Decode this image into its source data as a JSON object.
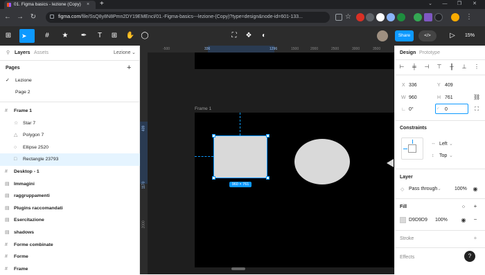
{
  "browser": {
    "tab_title": "01. Figma basics - lezione (Copy)",
    "tab_close": "×",
    "new_tab": "+",
    "url_host": "figma.com",
    "url_path": "/file/SsQ8y8N8Pmn2DY19EMEncI/01.-Figma-basics---lezione-(Copy)?type=design&node-id=601-133...",
    "window_controls": [
      "⌄",
      "—",
      "❐",
      "✕"
    ],
    "nav": {
      "back": "←",
      "forward": "→",
      "reload": "↻"
    },
    "icons": [
      "share-icon",
      "star-icon",
      "extension-icon",
      "profile-icon",
      "menu-icon"
    ]
  },
  "toolbar": {
    "main_menu": "⊞",
    "move": "➤",
    "frame": "#",
    "shape": "★",
    "pen": "✒",
    "text": "T",
    "hand": "✋",
    "comment": "◯",
    "share_label": "Share",
    "devmode_label": "</>",
    "present": "▷",
    "zoom_label": "15%"
  },
  "left_panel": {
    "tabs": [
      "Layers",
      "Assets"
    ],
    "page_select": "Lezione",
    "pages_title": "Pages",
    "add_page": "+",
    "pages": [
      {
        "name": "Lezione",
        "current": true
      },
      {
        "name": "Page 2",
        "current": false
      }
    ],
    "layers": [
      {
        "name": "Frame 1",
        "icon": "#",
        "depth": 0,
        "selected": false
      },
      {
        "name": "Star 7",
        "icon": "☆",
        "depth": 1,
        "selected": false
      },
      {
        "name": "Polygon 7",
        "icon": "△",
        "depth": 1,
        "selected": false
      },
      {
        "name": "Ellipse 2520",
        "icon": "○",
        "depth": 1,
        "selected": false
      },
      {
        "name": "Rectangle 23793",
        "icon": "□",
        "depth": 1,
        "selected": true
      },
      {
        "name": "Desktop - 1",
        "icon": "#",
        "depth": 0,
        "selected": false
      },
      {
        "name": "Immagini",
        "icon": "▤",
        "depth": 0,
        "selected": false
      },
      {
        "name": "raggruppamenti",
        "icon": "▤",
        "depth": 0,
        "selected": false
      },
      {
        "name": "Plugins raccomandati",
        "icon": "▤",
        "depth": 0,
        "selected": false
      },
      {
        "name": "Esercitazione",
        "icon": "▤",
        "depth": 0,
        "selected": false
      },
      {
        "name": "shadows",
        "icon": "▤",
        "depth": 0,
        "selected": false
      },
      {
        "name": "Forme combinate",
        "icon": "#",
        "depth": 0,
        "selected": false
      },
      {
        "name": "Forme",
        "icon": "#",
        "depth": 0,
        "selected": false
      },
      {
        "name": "Frame",
        "icon": "#",
        "depth": 0,
        "selected": false
      }
    ]
  },
  "canvas": {
    "frame_label": "Frame 1",
    "selection_size": "960 × 761",
    "ruler_top": [
      "-500",
      "336",
      "1296",
      "1500",
      "2000",
      "2500",
      "3000",
      "3500"
    ],
    "ruler_left": [
      "409",
      "1170",
      "2000"
    ]
  },
  "right_panel": {
    "tabs": [
      "Design",
      "Prototype"
    ],
    "x_label": "X",
    "x_value": "336",
    "y_label": "Y",
    "y_value": "409",
    "w_label": "W",
    "w_value": "960",
    "h_label": "H",
    "h_value": "761",
    "rotation_value": "0°",
    "radius_value": "0",
    "constraints_title": "Constraints",
    "constraint_h": "Left",
    "constraint_v": "Top",
    "layer_title": "Layer",
    "blend_mode": "Pass through",
    "layer_opacity": "100%",
    "fill_title": "Fill",
    "fill_hex": "D9D9D9",
    "fill_opacity": "100%",
    "stroke_title": "Stroke",
    "effects_title": "Effects",
    "help_label": "?",
    "colors": {
      "accent": "#0d99ff",
      "fill_swatch": "#d9d9d9"
    }
  }
}
